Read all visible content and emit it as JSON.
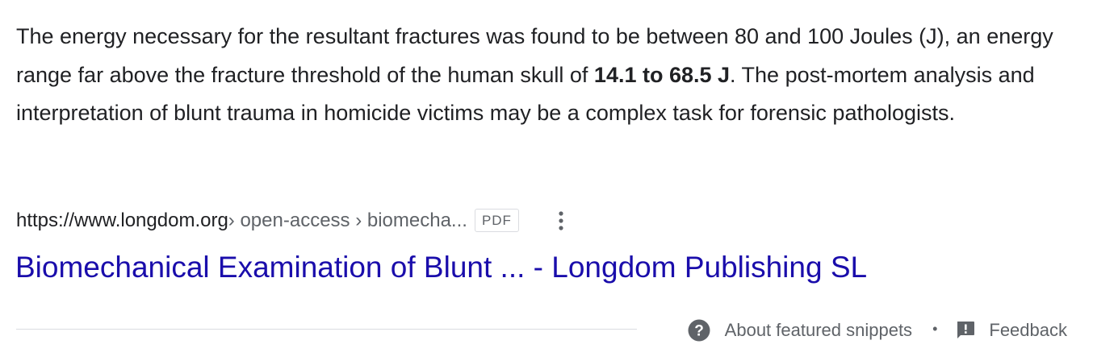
{
  "snippet": {
    "text_before_bold": "The energy necessary for the resultant fractures was found to be between 80 and 100 Joules (J), an energy range far above the fracture threshold of the human skull of ",
    "bold_text": "14.1 to 68.5 J",
    "text_after_bold": ". The post-mortem analysis and interpretation of blunt trauma in homicide victims may be a complex task for forensic pathologists."
  },
  "citation": {
    "host": "https://www.longdom.org",
    "path": " › open-access › biomecha...",
    "file_type_badge": "PDF",
    "more_icon": "three-dots-vertical-icon"
  },
  "result": {
    "title": "Biomechanical Examination of Blunt ... - Longdom Publishing SL",
    "title_color": "#1a0dab"
  },
  "footer": {
    "about_label": "About featured snippets",
    "about_icon": "help-circle-icon",
    "separator": "•",
    "feedback_label": "Feedback",
    "feedback_icon": "feedback-icon"
  },
  "colors": {
    "text": "#202124",
    "secondary_text": "#5f6368",
    "link": "#1a0dab",
    "divider": "#dadce0"
  }
}
